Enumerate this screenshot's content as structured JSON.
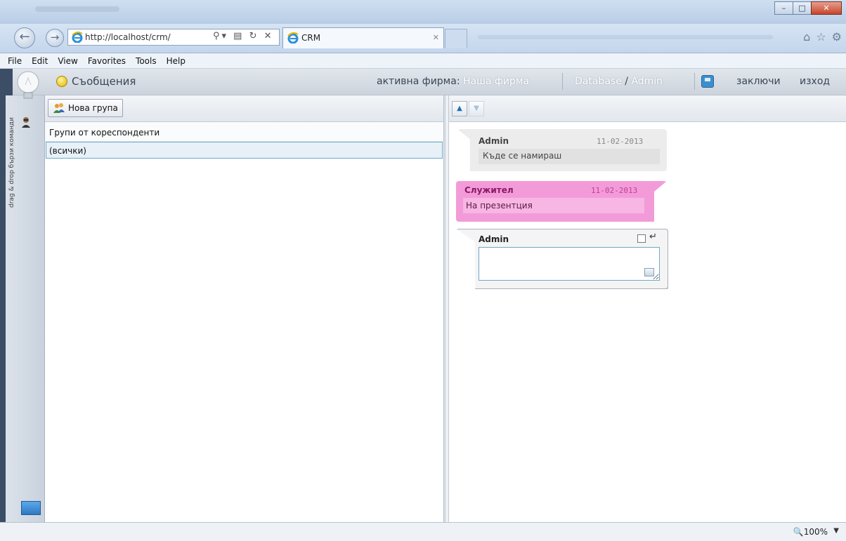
{
  "browser": {
    "address_url": "http://localhost/crm/",
    "tab_title": "CRM",
    "menu": [
      "File",
      "Edit",
      "View",
      "Favorites",
      "Tools",
      "Help"
    ]
  },
  "header": {
    "section_title": "Съобщения",
    "company_label": "активна фирма:",
    "company_name": "Наша фирма",
    "database": "Database",
    "admin": "Admin",
    "lock": "заключи",
    "exit": "изход"
  },
  "sidebar": {
    "vertical_text": "drag & drop бързи команди"
  },
  "left_panel": {
    "new_group_button": "Нова група",
    "groups_header": "Групи от кореспонденти",
    "groups": [
      "(всички)"
    ]
  },
  "messages": [
    {
      "author": "Admin",
      "date": "11-02-2013",
      "text": "Къде се намираш",
      "color": "#ececec"
    },
    {
      "author": "Служител",
      "date": "11-02-2013",
      "text": "На презентция",
      "color": "#f39bd8"
    }
  ],
  "compose": {
    "author": "Admin",
    "value": ""
  },
  "status": {
    "zoom": "100%"
  }
}
